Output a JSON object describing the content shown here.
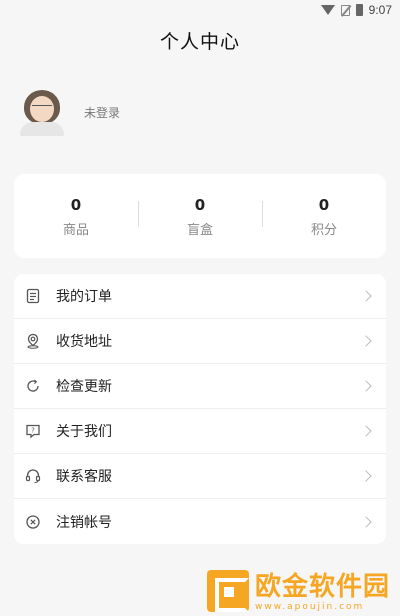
{
  "status_bar": {
    "time": "9:07"
  },
  "page_title": "个人中心",
  "profile": {
    "login_text": "未登录"
  },
  "stats": [
    {
      "value": "0",
      "label": "商品"
    },
    {
      "value": "0",
      "label": "盲盒"
    },
    {
      "value": "0",
      "label": "积分"
    }
  ],
  "menu": [
    {
      "label": "我的订单",
      "icon": "clipboard-icon"
    },
    {
      "label": "收货地址",
      "icon": "location-pin-icon"
    },
    {
      "label": "检查更新",
      "icon": "refresh-icon"
    },
    {
      "label": "关于我们",
      "icon": "question-bubble-icon"
    },
    {
      "label": "联系客服",
      "icon": "headset-icon"
    },
    {
      "label": "注销帐号",
      "icon": "close-circle-icon"
    }
  ],
  "watermark": {
    "title": "欧金软件园",
    "url": "www.apoujin.com"
  }
}
